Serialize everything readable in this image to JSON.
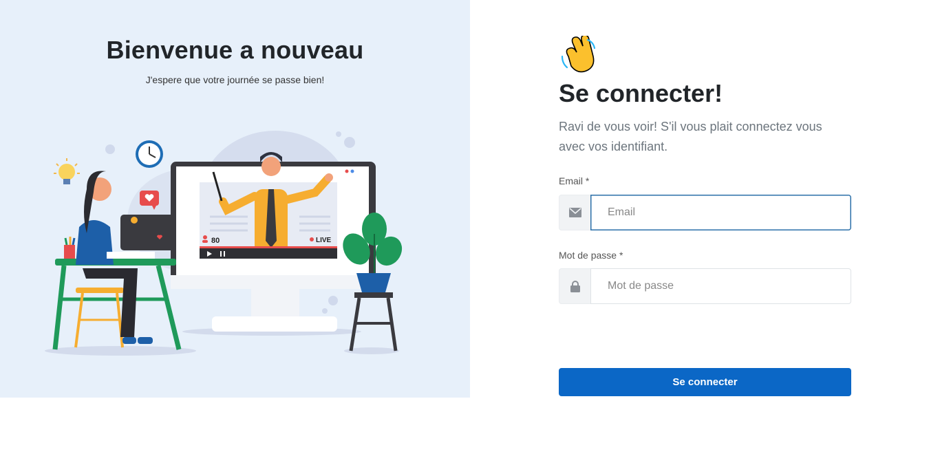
{
  "welcome": {
    "title": "Bienvenue a nouveau",
    "subtitle": "J'espere que votre journée se passe bien!"
  },
  "illustration": {
    "viewer_count": "80",
    "live_label": "LIVE"
  },
  "login": {
    "title": "Se connecter!",
    "subtitle": "Ravi de vous voir! S'il vous plait connectez vous avec vos identifiant.",
    "email_label": "Email *",
    "email_placeholder": "Email",
    "email_value": "",
    "password_label": "Mot de passe *",
    "password_placeholder": "Mot de passe",
    "password_value": "",
    "submit_label": "Se connecter"
  },
  "icons": {
    "wave": "waving-hand-icon",
    "email": "envelope-icon",
    "password": "lock-icon"
  },
  "colors": {
    "left_panel_bg": "#e7f0fa",
    "primary": "#0b67c6",
    "focus_border": "#2b6fa8"
  }
}
